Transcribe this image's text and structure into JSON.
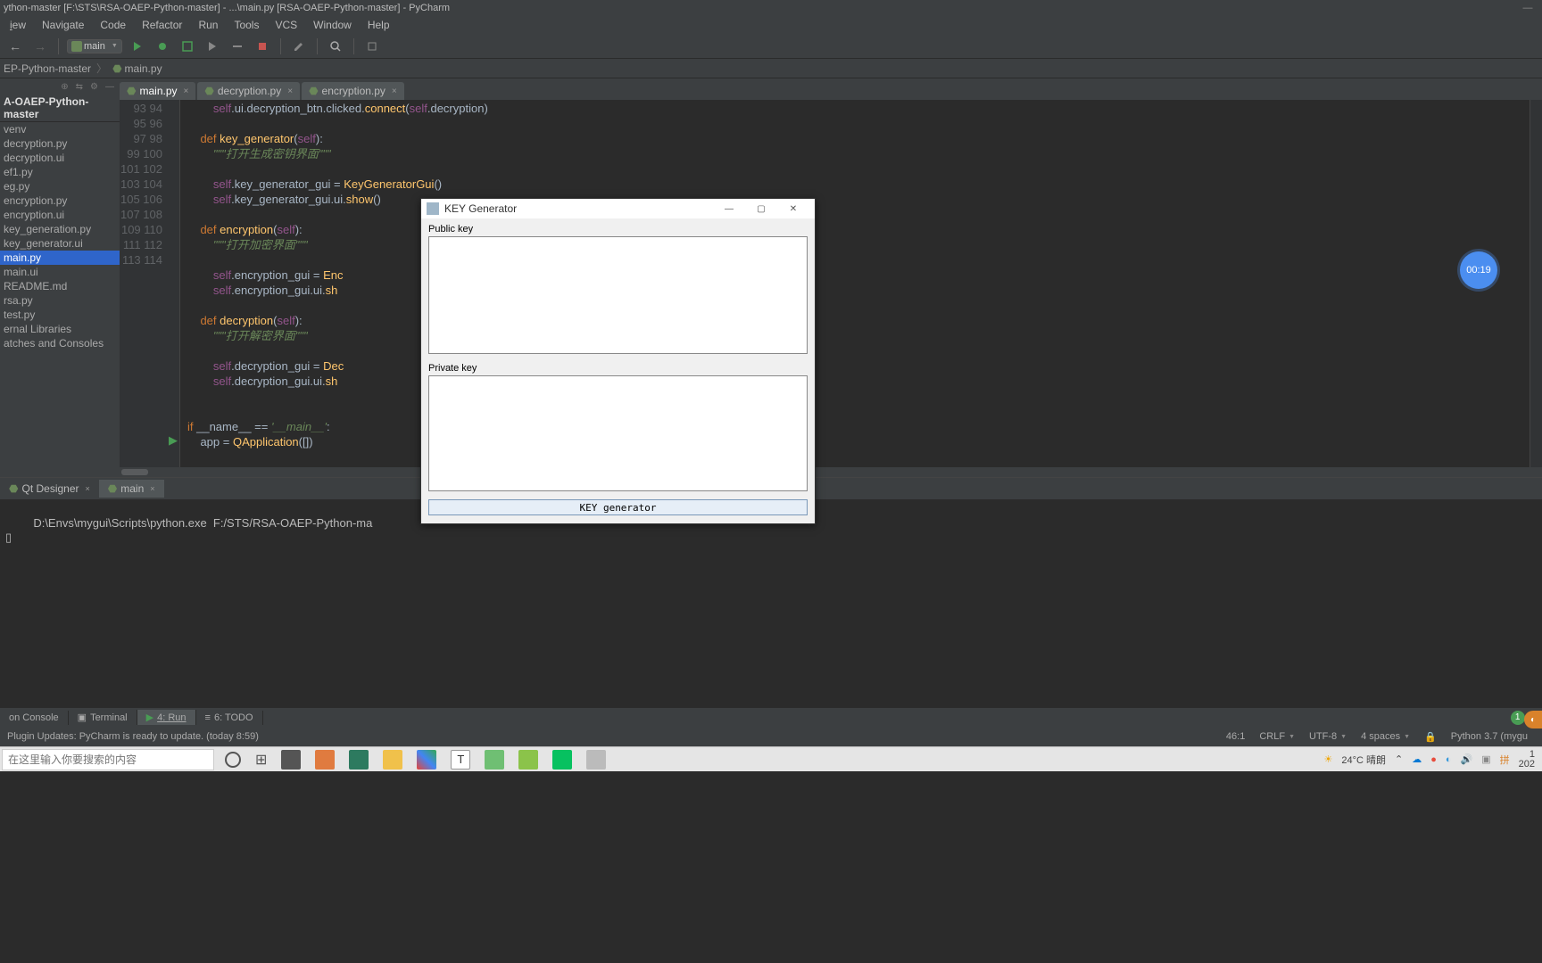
{
  "title": "ython-master [F:\\STS\\RSA-OAEP-Python-master] - ...\\main.py [RSA-OAEP-Python-master] - PyCharm",
  "menu": {
    "items": [
      "iew",
      "Navigate",
      "Code",
      "Refactor",
      "Run",
      "Tools",
      "VCS",
      "Window",
      "Help"
    ]
  },
  "toolbar": {
    "back": "←",
    "fwd": "→",
    "config": "main",
    "icons": [
      "run",
      "debug",
      "coverage",
      "more1",
      "more2",
      "stop",
      "edit",
      "search",
      "vcs"
    ]
  },
  "breadcrumb": {
    "items": [
      "EP-Python-master",
      "main.py"
    ]
  },
  "project": {
    "root": "A-OAEP-Python-master",
    "tree": [
      "venv",
      "decryption.py",
      "decryption.ui",
      "ef1.py",
      "eg.py",
      "encryption.py",
      "encryption.ui",
      "key_generation.py",
      "key_generator.ui",
      "main.py",
      "main.ui",
      "README.md",
      "rsa.py",
      "test.py",
      "ernal Libraries",
      "atches and Consoles"
    ],
    "selected": 9
  },
  "tabs": [
    {
      "label": "main.py",
      "active": true
    },
    {
      "label": "decryption.py",
      "active": false
    },
    {
      "label": "encryption.py",
      "active": false
    }
  ],
  "gutter": {
    "start": 93,
    "end": 114,
    "lines": [
      " ",
      "93",
      "94",
      "95",
      "96",
      "97",
      "98",
      "99",
      "100",
      "101",
      "102",
      "103",
      "104",
      "105",
      "106",
      "107",
      "108",
      "109",
      "110",
      "111",
      "112",
      "113",
      "114"
    ]
  },
  "code": {
    "l92": "        self.ui.decryption_btn.clicked.connect(self.decryption)",
    "l94a": "def",
    "l94b": "key_generator",
    "l94c": "self",
    "l95": "\"\"\"打开生成密钥界面\"\"\"",
    "l97a": "self",
    "l97b": ".key_generator_gui = ",
    "l97c": "KeyGeneratorGui",
    "l97d": "()",
    "l98a": "self",
    "l98b": ".key_generator_gui.ui.",
    "l98c": "show",
    "l98d": "()",
    "l100a": "def",
    "l100b": "encryption",
    "l100c": "self",
    "l101": "\"\"\"打开加密界面\"\"\"",
    "l103a": "self",
    "l103b": ".encryption_gui = ",
    "l103c": "Enc",
    "l104a": "self",
    "l104b": ".encryption_gui.ui.",
    "l104c": "sh",
    "l106a": "def",
    "l106b": "decryption",
    "l106c": "self",
    "l107": "\"\"\"打开解密界面\"\"\"",
    "l109a": "self",
    "l109b": ".decryption_gui = ",
    "l109c": "Dec",
    "l110a": "self",
    "l110b": ".decryption_gui.ui.",
    "l110c": "sh",
    "l113a": "if",
    "l113b": " __name__ == ",
    "l113c": "'__main__'",
    "l113d": ":",
    "l114a": "    app = ",
    "l114b": "QApplication",
    "l114c": "([])"
  },
  "runpanel": {
    "tabs": [
      {
        "label": "Qt Designer",
        "active": false
      },
      {
        "label": "main",
        "active": true
      }
    ],
    "output": "D:\\Envs\\mygui\\Scripts\\python.exe  F:/STS/RSA-OAEP-Python-ma",
    "cursor": "▯"
  },
  "toolwin": {
    "items": [
      "on Console",
      "Terminal",
      "4: Run",
      "6: TODO"
    ],
    "badge": "1",
    "event": "E"
  },
  "status": {
    "msg": "Plugin Updates: PyCharm is ready to update. (today 8:59)",
    "pos": "46:1",
    "crlf": "CRLF",
    "enc": "UTF-8",
    "indent": "4 spaces",
    "python": "Python 3.7 (mygu"
  },
  "dialog": {
    "title": "KEY Generator",
    "label_pub": "Public key",
    "label_priv": "Private key",
    "button": "KEY generator",
    "public_key": "",
    "private_key": ""
  },
  "timer": "00:19",
  "taskbar": {
    "search_placeholder": "在这里输入你要搜索的内容",
    "weather": "24°C 晴朗",
    "date_top": "1",
    "date_bottom": "202"
  }
}
